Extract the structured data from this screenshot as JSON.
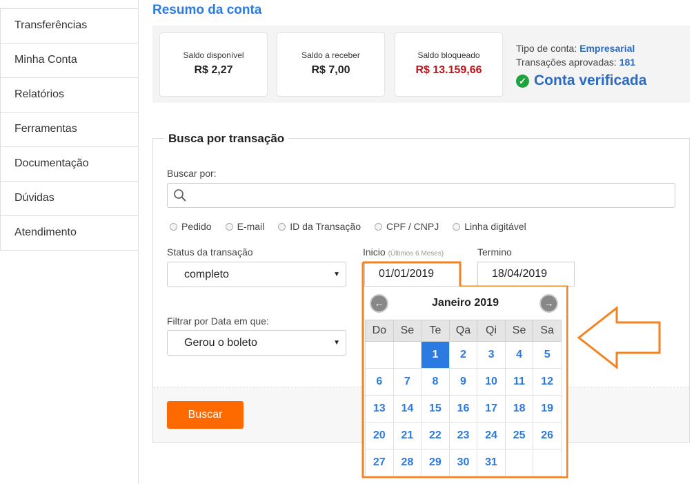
{
  "sidebar": {
    "items": [
      {
        "label": "Transferências"
      },
      {
        "label": "Minha Conta"
      },
      {
        "label": "Relatórios"
      },
      {
        "label": "Ferramentas"
      },
      {
        "label": "Documentação"
      },
      {
        "label": "Dúvidas"
      },
      {
        "label": "Atendimento"
      }
    ]
  },
  "summary": {
    "title": "Resumo da conta",
    "cards": [
      {
        "label": "Saldo disponível",
        "value": "R$ 2,27"
      },
      {
        "label": "Saldo a receber",
        "value": "R$ 7,00"
      },
      {
        "label": "Saldo bloqueado",
        "value": "R$ 13.159,66"
      }
    ],
    "account_type_label": "Tipo de conta:",
    "account_type": "Empresarial",
    "approved_label": "Transações aprovadas:",
    "approved_count": "181",
    "verified_text": "Conta verificada"
  },
  "search": {
    "title": "Busca por transação",
    "search_by_label": "Buscar por:",
    "search_value": "",
    "radios": [
      {
        "label": "Pedido"
      },
      {
        "label": "E-mail"
      },
      {
        "label": "ID da Transação"
      },
      {
        "label": "CPF / CNPJ"
      },
      {
        "label": "Linha digitável"
      }
    ],
    "status_label": "Status da transação",
    "status_value": "completo",
    "start_label": "Inicio",
    "start_hint": "(Últimos 6 Meses)",
    "start_value": "01/01/2019",
    "end_label": "Termino",
    "end_value": "18/04/2019",
    "filter_label": "Filtrar por Data em que:",
    "filter_value": "Gerou o boleto",
    "button_label": "Buscar"
  },
  "calendar": {
    "month": "Janeiro 2019",
    "weekdays": [
      "Do",
      "Se",
      "Te",
      "Qa",
      "Qi",
      "Se",
      "Sa"
    ],
    "weeks": [
      [
        "",
        "",
        "1",
        "2",
        "3",
        "4",
        "5"
      ],
      [
        "6",
        "7",
        "8",
        "9",
        "10",
        "11",
        "12"
      ],
      [
        "13",
        "14",
        "15",
        "16",
        "17",
        "18",
        "19"
      ],
      [
        "20",
        "21",
        "22",
        "23",
        "24",
        "25",
        "26"
      ],
      [
        "27",
        "28",
        "29",
        "30",
        "31",
        "",
        ""
      ]
    ],
    "selected": "1",
    "highlight_color": "#f58220"
  },
  "colors": {
    "accent_blue": "#2a7ae2",
    "blocked_red": "#c0141a",
    "button_orange": "#ff6a00",
    "verified_green": "#1fa33d"
  }
}
